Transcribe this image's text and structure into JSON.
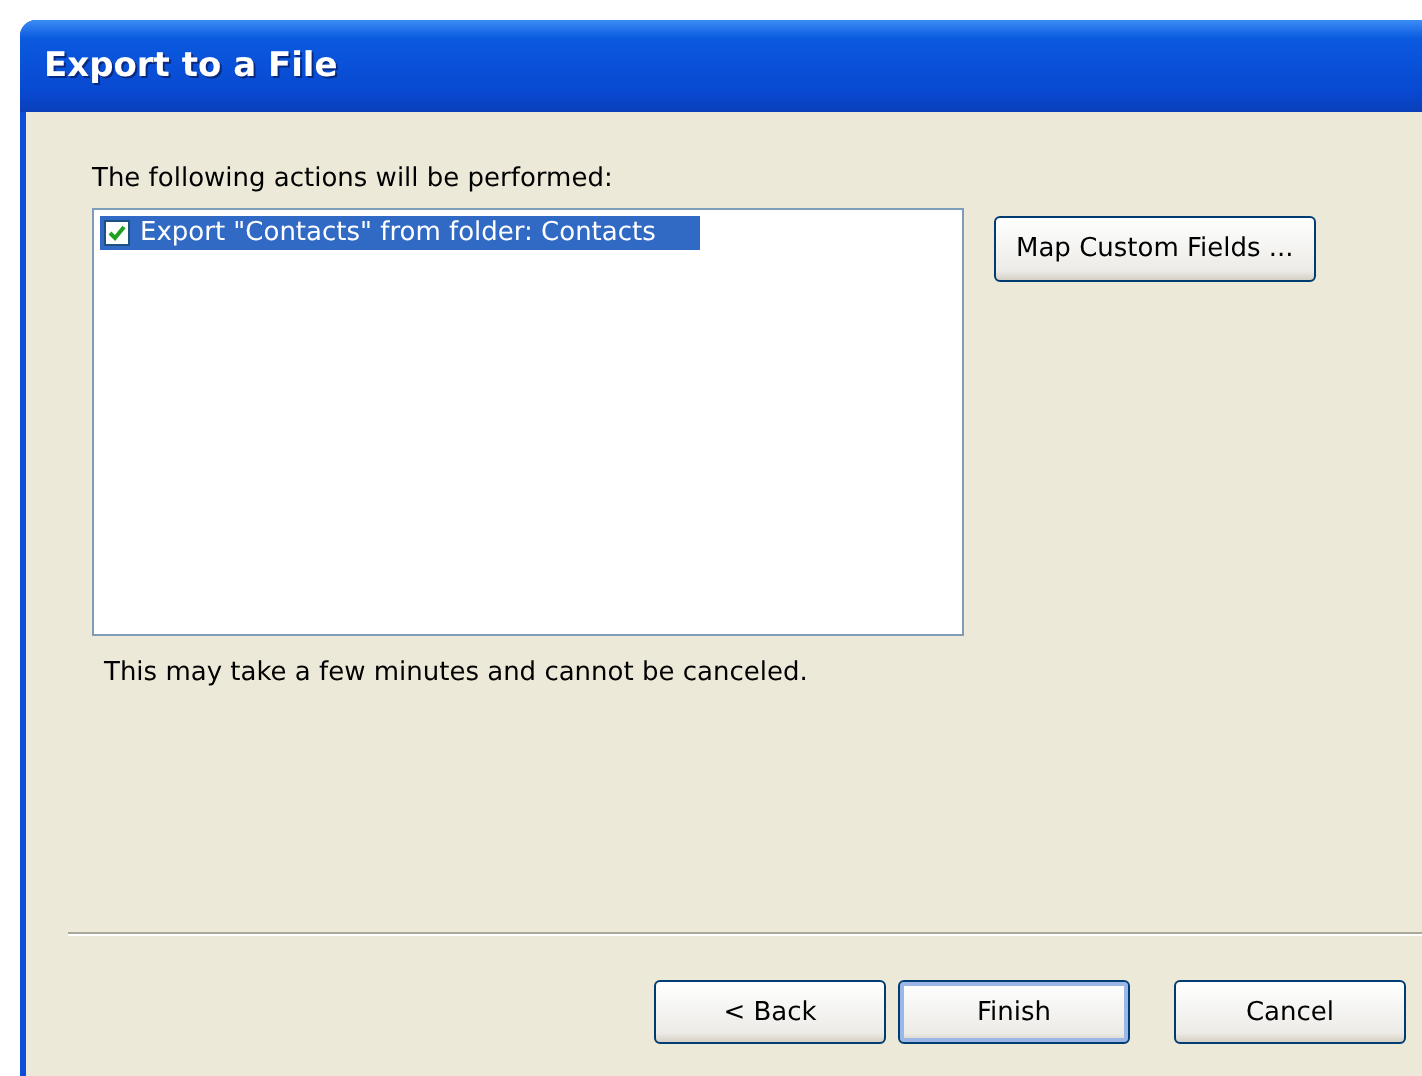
{
  "window": {
    "title": "Export to a File"
  },
  "actions_label": "The following actions will be performed:",
  "actions": [
    {
      "label": "Export \"Contacts\" from folder: Contacts",
      "checked": true,
      "selected": true
    }
  ],
  "map_button": "Map Custom Fields ...",
  "note": "This may take a few minutes and cannot be canceled.",
  "buttons": [
    {
      "label": "< Back",
      "default": false
    },
    {
      "label": "Finish",
      "default": true
    },
    {
      "label": "Cancel",
      "default": false
    }
  ]
}
